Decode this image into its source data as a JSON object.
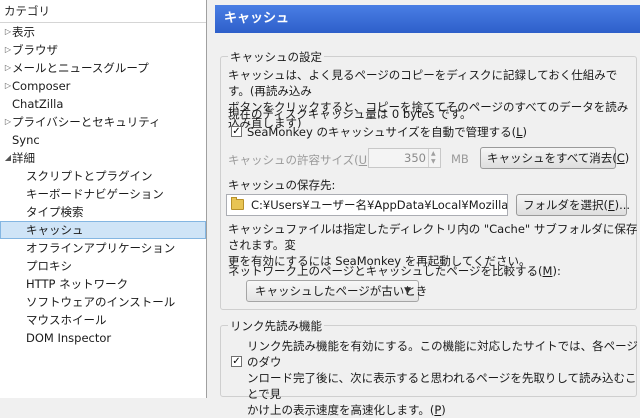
{
  "sidebar": {
    "header": "カテゴリ",
    "items": [
      {
        "label": "表示",
        "twisty": "▷",
        "level": 0
      },
      {
        "label": "ブラウザ",
        "twisty": "▷",
        "level": 0
      },
      {
        "label": "メールとニュースグループ",
        "twisty": "▷",
        "level": 0
      },
      {
        "label": "Composer",
        "twisty": "▷",
        "level": 0
      },
      {
        "label": "ChatZilla",
        "twisty": "",
        "level": 0
      },
      {
        "label": "プライバシーとセキュリティ",
        "twisty": "▷",
        "level": 0
      },
      {
        "label": "Sync",
        "twisty": "",
        "level": 0
      },
      {
        "label": "詳細",
        "twisty": "◢",
        "level": 0
      },
      {
        "label": "スクリプトとプラグイン",
        "twisty": "",
        "level": 1
      },
      {
        "label": "キーボードナビゲーション",
        "twisty": "",
        "level": 1
      },
      {
        "label": "タイプ検索",
        "twisty": "",
        "level": 1
      },
      {
        "label": "キャッシュ",
        "twisty": "",
        "level": 1,
        "selected": true
      },
      {
        "label": "オフラインアプリケーション",
        "twisty": "",
        "level": 1
      },
      {
        "label": "プロキシ",
        "twisty": "",
        "level": 1
      },
      {
        "label": "HTTP ネットワーク",
        "twisty": "",
        "level": 1
      },
      {
        "label": "ソフトウェアのインストール",
        "twisty": "",
        "level": 1
      },
      {
        "label": "マウスホイール",
        "twisty": "",
        "level": 1
      },
      {
        "label": "DOM Inspector",
        "twisty": "",
        "level": 1
      }
    ]
  },
  "header": {
    "title": "キャッシュ",
    "accent": "#3c6fd8"
  },
  "cache_settings": {
    "legend": "キャッシュの設定",
    "description_line1": "キャッシュは、よく見るページのコピーをディスクに記録しておく仕組みです。(再読み込み",
    "description_line2": "ボタンをクリックすると、コピーを捨ててそのページのすべてのデータを読み込み直します)",
    "current_size": "現在のディスクキャッシュ量は 0 bytes です。",
    "auto_manage_label": "SeaMonkey のキャッシュサイズを自動で管理する(",
    "auto_manage_key": "L",
    "auto_manage_checked": "✓",
    "allowed_size_label": "キャッシュの許容サイズ(",
    "allowed_size_key": "U",
    "allowed_size_suffix": "):",
    "allowed_size_value": "350",
    "allowed_size_unit": "MB",
    "clear_button_label": "キャッシュをすべて消去(",
    "clear_button_key": "C",
    "location_label": "キャッシュの保存先:",
    "location_path": "C:¥Users¥ユーザー名¥AppData¥Local¥Mozilla",
    "choose_folder_label": "フォルダを選択(",
    "choose_folder_key": "F",
    "choose_folder_suffix": ")...",
    "note_line1": "キャッシュファイルは指定したディレクトリ内の \"Cache\" サブフォルダに保存されます。変",
    "note_line2": "更を有効にするには SeaMonkey を再起動してください。",
    "compare_label": "ネットワーク上のページとキャッシュしたページを比較する(",
    "compare_key": "M",
    "compare_suffix": "):",
    "compare_value": "キャッシュしたページが古いとき",
    "chevron_icon": "chevron-down-icon"
  },
  "prefetch": {
    "legend": "リンク先読み機能",
    "checked": "✓",
    "line1": "リンク先読み機能を有効にする。この機能に対応したサイトでは、各ページのダウ",
    "line2": "ンロード完了後に、次に表示すると思われるページを先取りして読み込むことで見",
    "line3": "かけ上の表示速度を高速化します。(",
    "key": "P",
    "suffix": ")"
  }
}
